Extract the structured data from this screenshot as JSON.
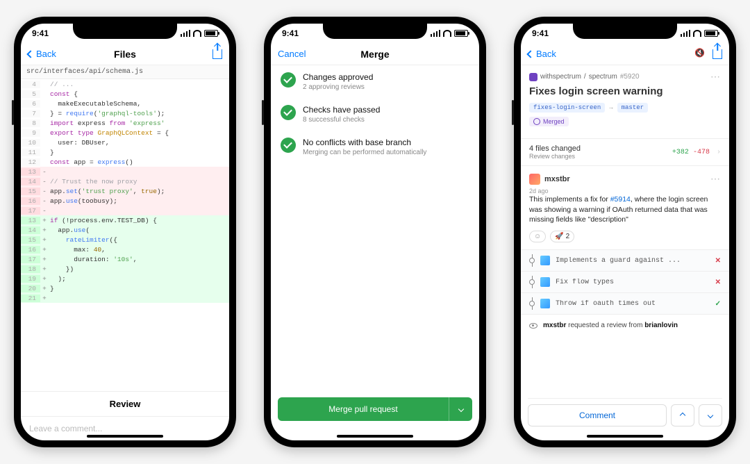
{
  "status": {
    "time": "9:41"
  },
  "phone1": {
    "nav": {
      "back": "Back",
      "title": "Files"
    },
    "path": "src/interfaces/api/schema.js",
    "code": [
      {
        "n": 4,
        "m": "",
        "kind": "",
        "html": "<span class='cm'>// ...</span>"
      },
      {
        "n": 5,
        "m": "",
        "kind": "",
        "html": "<span class='kw'>const</span> {"
      },
      {
        "n": 6,
        "m": "",
        "kind": "",
        "html": "  makeExecutableSchema,"
      },
      {
        "n": 7,
        "m": "",
        "kind": "",
        "html": "} = <span class='fn'>require</span>(<span class='str'>'graphql-tools'</span>);"
      },
      {
        "n": 8,
        "m": "",
        "kind": "",
        "html": "<span class='kw'>import</span> express <span class='kw'>from</span> <span class='str'>'express'</span>"
      },
      {
        "n": 9,
        "m": "",
        "kind": "",
        "html": "<span class='kw'>export</span> <span class='kw'>type</span> <span class='ty'>GraphQLContext</span> = {"
      },
      {
        "n": 10,
        "m": "",
        "kind": "",
        "html": "  user: DBUser,"
      },
      {
        "n": 11,
        "m": "",
        "kind": "",
        "html": "}"
      },
      {
        "n": 12,
        "m": "",
        "kind": "",
        "html": "<span class='kw'>const</span> app = <span class='fn'>express</span>()"
      },
      {
        "n": 13,
        "m": "-",
        "kind": "del",
        "html": ""
      },
      {
        "n": 14,
        "m": "-",
        "kind": "del",
        "html": "<span class='cm'>// Trust the now proxy</span>"
      },
      {
        "n": 15,
        "m": "-",
        "kind": "del",
        "html": "app.<span class='fn'>set</span>(<span class='str'>'trust proxy'</span>, <span class='nm'>true</span>);"
      },
      {
        "n": 16,
        "m": "-",
        "kind": "del",
        "html": "app.<span class='fn'>use</span>(toobusy);"
      },
      {
        "n": 17,
        "m": "-",
        "kind": "del",
        "html": ""
      },
      {
        "n": 13,
        "m": "+",
        "kind": "add",
        "html": "<span class='kw'>if</span> (!process.env.TEST_DB) {"
      },
      {
        "n": 14,
        "m": "+",
        "kind": "add",
        "html": "  app.<span class='fn'>use</span>("
      },
      {
        "n": 15,
        "m": "+",
        "kind": "add",
        "html": "    <span class='fn'>rateLimiter</span>({"
      },
      {
        "n": 16,
        "m": "+",
        "kind": "add",
        "html": "      max: <span class='nm'>40</span>,"
      },
      {
        "n": 17,
        "m": "+",
        "kind": "add",
        "html": "      duration: <span class='str'>'10s'</span>,"
      },
      {
        "n": 18,
        "m": "+",
        "kind": "add",
        "html": "    })"
      },
      {
        "n": 19,
        "m": "+",
        "kind": "add",
        "html": "  );"
      },
      {
        "n": 20,
        "m": "+",
        "kind": "add",
        "html": "}"
      },
      {
        "n": 21,
        "m": "+",
        "kind": "add",
        "html": ""
      }
    ],
    "review": "Review",
    "comment_placeholder": "Leave a comment..."
  },
  "phone2": {
    "nav": {
      "cancel": "Cancel",
      "title": "Merge"
    },
    "items": [
      {
        "title": "Changes approved",
        "sub": "2 approving reviews"
      },
      {
        "title": "Checks have passed",
        "sub": "8 successful checks"
      },
      {
        "title": "No conflicts with base branch",
        "sub": "Merging can be performed automatically"
      }
    ],
    "button": "Merge pull request"
  },
  "phone3": {
    "nav": {
      "back": "Back"
    },
    "crumb": {
      "owner": "withspectrum",
      "repo": "spectrum",
      "number": "#5920"
    },
    "title": "Fixes login screen warning",
    "branch_head": "fixes-login-screen",
    "branch_base": "master",
    "merged": "Merged",
    "files": {
      "title": "4 files changed",
      "sub": "Review changes",
      "plus": "+382",
      "minus": "-478"
    },
    "comment": {
      "user": "mxstbr",
      "ago": "2d ago",
      "body_pre": "This implements a fix for ",
      "issue": "#5914",
      "body_post": ", where the login screen was showing a warning if OAuth returned data that was missing fields like \"description\"",
      "rocket_count": "2"
    },
    "commits": [
      {
        "msg": "Implements a guard against ...",
        "status": "fail"
      },
      {
        "msg": "Fix flow types",
        "status": "fail"
      },
      {
        "msg": "Throw if oauth times out",
        "status": "pass"
      }
    ],
    "review_request": {
      "actor": "mxstbr",
      "text": " requested a review from ",
      "target": "brianlovin"
    },
    "comment_btn": "Comment"
  }
}
